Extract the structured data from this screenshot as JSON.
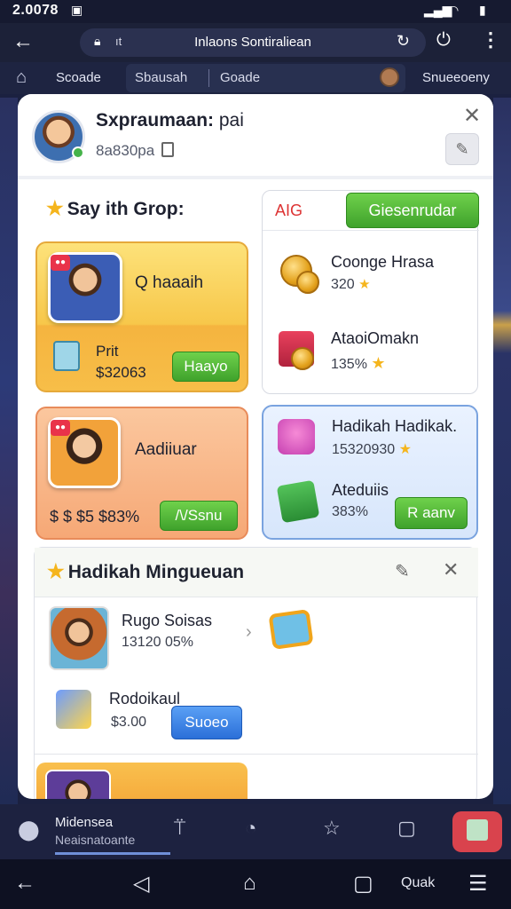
{
  "status": {
    "time": "2.0078",
    "icons": [
      "notification-icon",
      "signal-icon",
      "wifi-icon",
      "battery-icon"
    ]
  },
  "browser": {
    "url": "Inlaons Sontiraliean",
    "x_label": "ıt"
  },
  "nav": {
    "tab1": "Scoade",
    "tab2": "Sbausah",
    "tab3": "Goade",
    "tab4": "Snueeoeny"
  },
  "modal": {
    "title_bold": "Sxpraumaan:",
    "title_rest": " pai",
    "subtitle": "8a830pa",
    "section1_title": "Say ith Grop:",
    "card1": {
      "title": "Q haaaih",
      "line1": "Prit",
      "line2": "$32063",
      "button": "Haayo"
    },
    "card2": {
      "title": "Aadiiuar",
      "line1": "$ $ $5 $83%",
      "button": "/\\/Ssnu"
    },
    "panel": {
      "label": "AIG",
      "button": "Giesenrudar",
      "item1": {
        "title": "Coonge Hrasa",
        "value": "320"
      },
      "item2": {
        "title": "AtaoiOmakn",
        "value": "135%"
      }
    },
    "card3": {
      "title": "Hadikah Hadikak.",
      "value": "15320930",
      "title2": "Ateduiis",
      "value2": "383%",
      "button": "R aanv"
    },
    "section2": {
      "title": "Hadikah Mingueuan",
      "row1": {
        "title": "Rugo Soisas",
        "value": "13120 05%"
      },
      "row2": {
        "title": "Rodoikaul",
        "value": "$3.00",
        "button": "Suoeo"
      }
    }
  },
  "bottom": {
    "label1": "Midensea",
    "label2": "Neaisnatoante"
  },
  "sysnav": {
    "label": "Quak"
  }
}
